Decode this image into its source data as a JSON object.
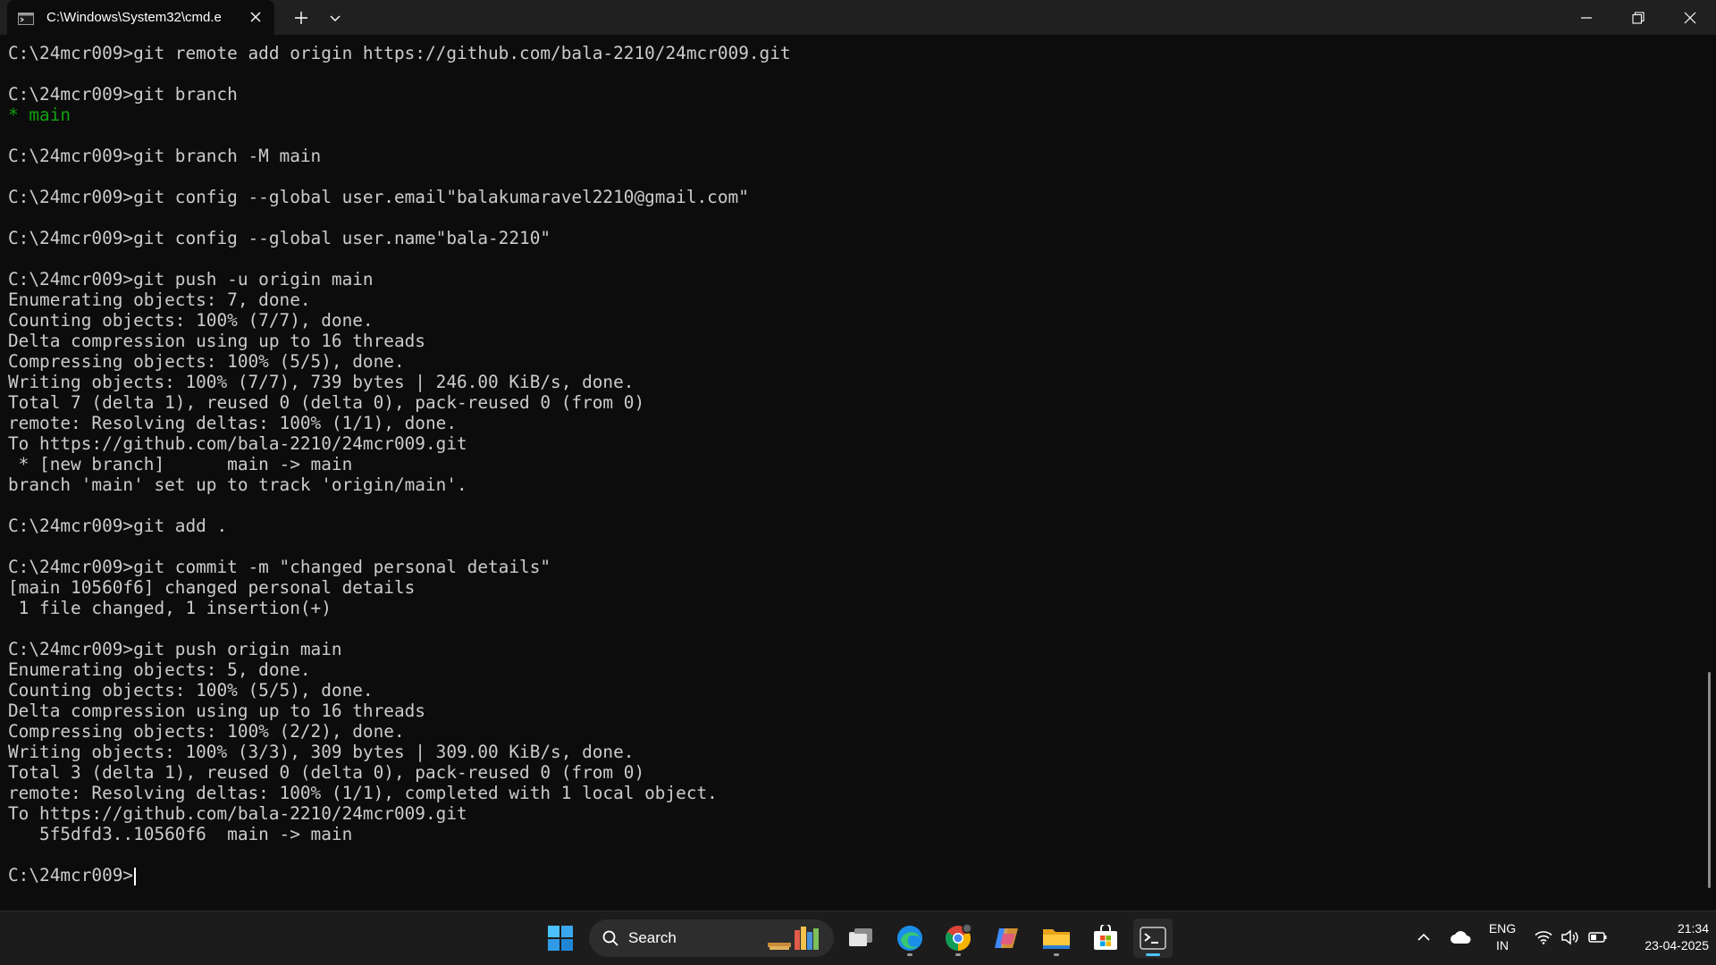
{
  "titlebar": {
    "tab_title": "C:\\Windows\\System32\\cmd.e",
    "icons": {
      "tab": "cmd-icon",
      "close": "close-icon",
      "new_tab": "plus-icon",
      "dropdown": "chevron-down-icon",
      "minimize": "minimize-icon",
      "maximize": "restore-icon",
      "window_close": "close-icon"
    }
  },
  "terminal": {
    "lines": [
      {
        "text": "C:\\24mcr009>git remote add origin https://github.com/bala-2210/24mcr009.git",
        "style": ""
      },
      {
        "text": "",
        "style": ""
      },
      {
        "text": "C:\\24mcr009>git branch",
        "style": ""
      },
      {
        "text": "* main",
        "style": "green-branch"
      },
      {
        "text": "",
        "style": ""
      },
      {
        "text": "C:\\24mcr009>git branch -M main",
        "style": ""
      },
      {
        "text": "",
        "style": ""
      },
      {
        "text": "C:\\24mcr009>git config --global user.email\"balakumaravel2210@gmail.com\"",
        "style": ""
      },
      {
        "text": "",
        "style": ""
      },
      {
        "text": "C:\\24mcr009>git config --global user.name\"bala-2210\"",
        "style": ""
      },
      {
        "text": "",
        "style": ""
      },
      {
        "text": "C:\\24mcr009>git push -u origin main",
        "style": ""
      },
      {
        "text": "Enumerating objects: 7, done.",
        "style": ""
      },
      {
        "text": "Counting objects: 100% (7/7), done.",
        "style": ""
      },
      {
        "text": "Delta compression using up to 16 threads",
        "style": ""
      },
      {
        "text": "Compressing objects: 100% (5/5), done.",
        "style": ""
      },
      {
        "text": "Writing objects: 100% (7/7), 739 bytes | 246.00 KiB/s, done.",
        "style": ""
      },
      {
        "text": "Total 7 (delta 1), reused 0 (delta 0), pack-reused 0 (from 0)",
        "style": ""
      },
      {
        "text": "remote: Resolving deltas: 100% (1/1), done.",
        "style": ""
      },
      {
        "text": "To https://github.com/bala-2210/24mcr009.git",
        "style": ""
      },
      {
        "text": " * [new branch]      main -> main",
        "style": ""
      },
      {
        "text": "branch 'main' set up to track 'origin/main'.",
        "style": ""
      },
      {
        "text": "",
        "style": ""
      },
      {
        "text": "C:\\24mcr009>git add .",
        "style": ""
      },
      {
        "text": "",
        "style": ""
      },
      {
        "text": "C:\\24mcr009>git commit -m \"changed personal details\"",
        "style": ""
      },
      {
        "text": "[main 10560f6] changed personal details",
        "style": ""
      },
      {
        "text": " 1 file changed, 1 insertion(+)",
        "style": ""
      },
      {
        "text": "",
        "style": ""
      },
      {
        "text": "C:\\24mcr009>git push origin main",
        "style": ""
      },
      {
        "text": "Enumerating objects: 5, done.",
        "style": ""
      },
      {
        "text": "Counting objects: 100% (5/5), done.",
        "style": ""
      },
      {
        "text": "Delta compression using up to 16 threads",
        "style": ""
      },
      {
        "text": "Compressing objects: 100% (2/2), done.",
        "style": ""
      },
      {
        "text": "Writing objects: 100% (3/3), 309 bytes | 309.00 KiB/s, done.",
        "style": ""
      },
      {
        "text": "Total 3 (delta 1), reused 0 (delta 0), pack-reused 0 (from 0)",
        "style": ""
      },
      {
        "text": "remote: Resolving deltas: 100% (1/1), completed with 1 local object.",
        "style": ""
      },
      {
        "text": "To https://github.com/bala-2210/24mcr009.git",
        "style": ""
      },
      {
        "text": "   5f5dfd3..10560f6  main -> main",
        "style": ""
      },
      {
        "text": "",
        "style": ""
      }
    ],
    "prompt": "C:\\24mcr009>",
    "colors": {
      "text": "#cccccc",
      "branch": "#13a10e",
      "background": "#0c0c0c"
    }
  },
  "taskbar": {
    "search_label": "Search",
    "apps": [
      "windows-start-icon",
      "search-icon",
      "task-view-icon",
      "edge-icon",
      "chrome-icon",
      "copilot-icon",
      "file-explorer-icon",
      "microsoft-store-icon",
      "terminal-icon"
    ],
    "tray": {
      "lang_primary": "ENG",
      "lang_secondary": "IN",
      "time": "21:34",
      "date": "23-04-2025",
      "icons": [
        "chevron-up-icon",
        "onedrive-cloud-icon",
        "wifi-icon",
        "volume-icon",
        "battery-icon"
      ]
    }
  }
}
